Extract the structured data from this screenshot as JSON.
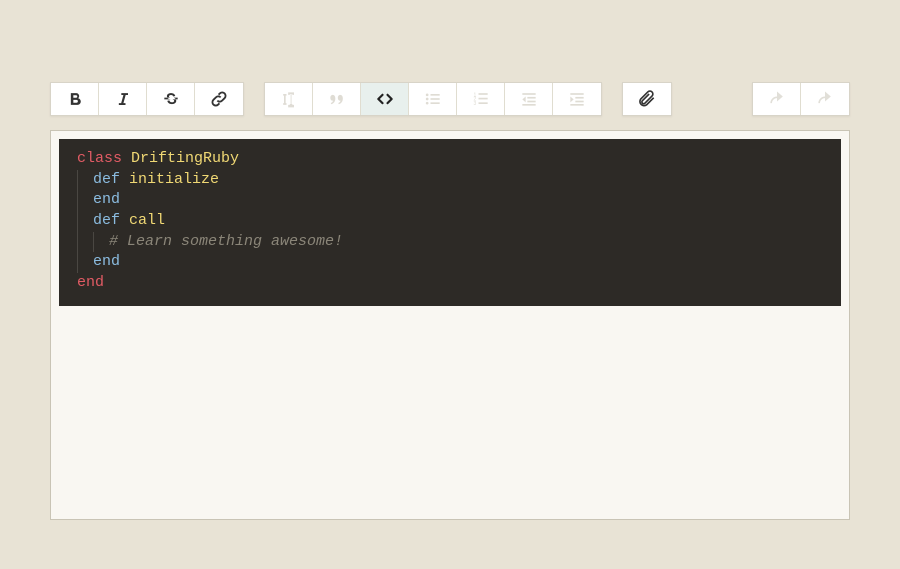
{
  "toolbar": {
    "bold": "bold",
    "italic": "italic",
    "strike": "strikethrough",
    "link": "link",
    "heading": "heading",
    "quote": "quote",
    "code": "code",
    "ul": "bullet-list",
    "ol": "numbered-list",
    "outdent": "outdent",
    "indent": "indent",
    "attach": "attach",
    "undo": "undo",
    "redo": "redo"
  },
  "code": {
    "t_class": "class",
    "t_classname": "DriftingRuby",
    "t_def": "def",
    "t_init": "initialize",
    "t_end": "end",
    "t_call": "call",
    "t_comment": "# Learn something awesome!"
  }
}
